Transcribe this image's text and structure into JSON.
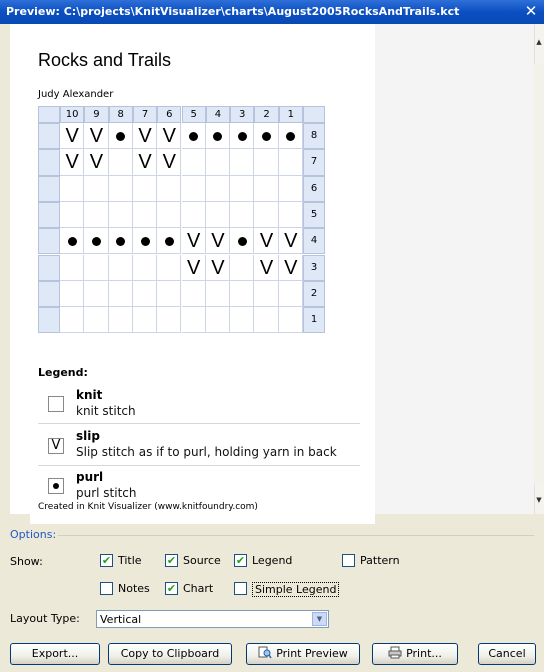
{
  "window": {
    "title": "Preview: C:\\projects\\KnitVisualizer\\charts\\August2005RocksAndTrails.kct",
    "close_glyph": "✕"
  },
  "chart": {
    "title": "Rocks and Trails",
    "source": "Judy Alexander",
    "columns": [
      "10",
      "9",
      "8",
      "7",
      "6",
      "5",
      "4",
      "3",
      "2",
      "1"
    ],
    "rows": [
      {
        "num": "8",
        "cells": [
          "V",
          "V",
          "•",
          "V",
          "V",
          "•",
          "•",
          "•",
          "•",
          "•"
        ]
      },
      {
        "num": "7",
        "cells": [
          "V",
          "V",
          "",
          "V",
          "V",
          "",
          "",
          "",
          "",
          ""
        ]
      },
      {
        "num": "6",
        "cells": [
          "",
          "",
          "",
          "",
          "",
          "",
          "",
          "",
          "",
          ""
        ]
      },
      {
        "num": "5",
        "cells": [
          "",
          "",
          "",
          "",
          "",
          "",
          "",
          "",
          "",
          ""
        ]
      },
      {
        "num": "4",
        "cells": [
          "•",
          "•",
          "•",
          "•",
          "•",
          "V",
          "V",
          "•",
          "V",
          "V"
        ]
      },
      {
        "num": "3",
        "cells": [
          "",
          "",
          "",
          "",
          "",
          "V",
          "V",
          "",
          "V",
          "V"
        ]
      },
      {
        "num": "2",
        "cells": [
          "",
          "",
          "",
          "",
          "",
          "",
          "",
          "",
          "",
          ""
        ]
      },
      {
        "num": "1",
        "cells": [
          "",
          "",
          "",
          "",
          "",
          "",
          "",
          "",
          "",
          ""
        ]
      }
    ]
  },
  "legend": {
    "heading": "Legend:",
    "items": [
      {
        "symbol": "",
        "name": "knit",
        "desc": "knit stitch"
      },
      {
        "symbol": "V",
        "name": "slip",
        "desc": "Slip stitch as if to purl, holding yarn in back"
      },
      {
        "symbol": "•",
        "name": "purl",
        "desc": "purl stitch"
      }
    ]
  },
  "created": "Created in Knit Visualizer (www.knitfoundry.com)",
  "options": {
    "title": "Options:",
    "show_label": "Show:",
    "title_cb": {
      "label": "Title",
      "checked": true
    },
    "source_cb": {
      "label": "Source",
      "checked": true
    },
    "legend_cb": {
      "label": "Legend",
      "checked": true
    },
    "pattern_cb": {
      "label": "Pattern",
      "checked": false
    },
    "notes_cb": {
      "label": "Notes",
      "checked": false
    },
    "chart_cb": {
      "label": "Chart",
      "checked": true
    },
    "simple_legend_cb": {
      "label": "Simple Legend",
      "checked": false
    },
    "layout_label": "Layout Type:",
    "layout_value": "Vertical"
  },
  "buttons": {
    "export": "Export...",
    "copy": "Copy to Clipboard",
    "print_preview": "Print Preview",
    "print": "Print...",
    "cancel": "Cancel"
  },
  "colors": {
    "accent": "#2358c2",
    "titlebar": "#0b4fc1",
    "check": "#21a121"
  }
}
